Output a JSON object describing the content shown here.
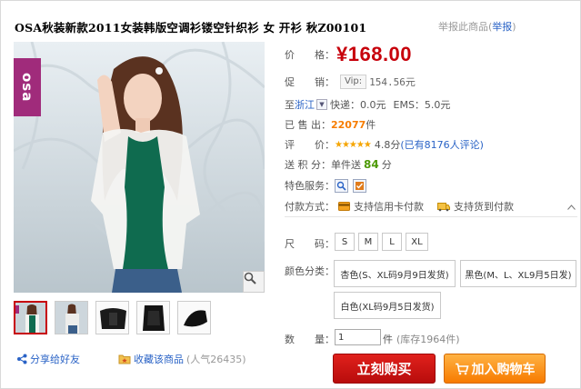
{
  "title": "OSA秋装新款2011女装韩版空调衫镂空针织衫 女 开衫 秋Z00101",
  "report": {
    "prefix": "举报此商品(",
    "link": "举报",
    "suffix": ")"
  },
  "brand_tag": "osa",
  "price": {
    "label": "价　　格：",
    "value": "¥168.00"
  },
  "promo": {
    "label": "促　　销：",
    "vip_tag": "Vip:",
    "vip_price": "154.56元"
  },
  "shipping": {
    "to_label": "至",
    "region": "浙江",
    "express": "快递：0.0元",
    "ems": "EMS：5.0元"
  },
  "sold": {
    "label": "已 售 出：",
    "count": "22077",
    "unit": "件"
  },
  "review": {
    "label": "评　　价：",
    "stars": "★★★★★",
    "score": "4.8分",
    "reviews": "(已有8176人评论)"
  },
  "points": {
    "label": "送 积 分：",
    "prefix": "单件送",
    "value": "84",
    "unit": "分"
  },
  "services": {
    "label": "特色服务："
  },
  "payment": {
    "label": "付款方式：",
    "option1": "支持信用卡付款",
    "option2": "支持货到付款"
  },
  "size": {
    "label": "尺　　码：",
    "options": [
      "S",
      "M",
      "L",
      "XL"
    ]
  },
  "color": {
    "label": "颜色分类：",
    "options": [
      "杏色(S、XL码9月9日发货)",
      "黑色(M、L、XL9月5日发)",
      "白色(XL码9月5日发货)"
    ]
  },
  "quantity": {
    "label": "数　　量：",
    "value": "1",
    "unit": "件",
    "stock": "(库存1964件)"
  },
  "buttons": {
    "buy": "立刻购买",
    "cart": "加入购物车"
  },
  "share": "分享给好友",
  "favorite": {
    "label": "收藏该商品",
    "popularity": "(人气26435)"
  },
  "colors": {
    "price_red": "#c7000b",
    "link_blue": "#2a63c6",
    "sold_orange": "#f77d00",
    "points_green": "#4e9a06",
    "brand_purple": "#a02b7b"
  }
}
